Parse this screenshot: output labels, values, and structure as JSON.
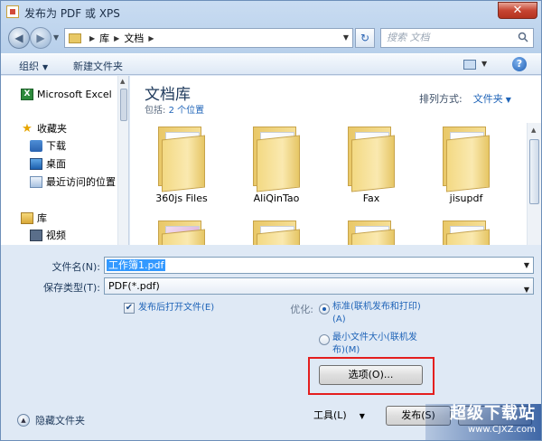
{
  "window": {
    "title": "发布为 PDF 或 XPS",
    "close": "✕"
  },
  "address": {
    "items": [
      "库",
      "文档"
    ],
    "search_placeholder": "搜索 文档"
  },
  "toolbar": {
    "organize": "组织",
    "new_folder": "新建文件夹",
    "help": "?"
  },
  "nav": {
    "items": [
      {
        "label": "Microsoft Excel"
      },
      {
        "label": "收藏夹"
      },
      {
        "label": "下载"
      },
      {
        "label": "桌面"
      },
      {
        "label": "最近访问的位置"
      },
      {
        "label": "库"
      },
      {
        "label": "视频"
      }
    ]
  },
  "main": {
    "title": "文档库",
    "includes_prefix": "包括:",
    "includes_link": "2 个位置",
    "arrange_label": "排列方式:",
    "arrange_value": "文件夹",
    "folders": [
      "360js Files",
      "AliQinTao",
      "Fax",
      "jisupdf"
    ]
  },
  "form": {
    "filename_label": "文件名(N):",
    "filename_value": "工作簿1.pdf",
    "filetype_label": "保存类型(T):",
    "filetype_value": "PDF(*.pdf)",
    "open_after": "发布后打开文件(E)",
    "optimize_label": "优化:",
    "opt_standard_1": "标准(联机发布和打印)",
    "opt_standard_2": "(A)",
    "opt_min_1": "最小文件大小(联机发",
    "opt_min_2": "布)(M)",
    "options_button": "选项(O)...",
    "tools_button": "工具(L)",
    "publish_button": "发布(S)",
    "hide_folders": "隐藏文件夹"
  },
  "watermark": {
    "big": "超级下载站",
    "small": "www.CJXZ.com"
  },
  "colors": {
    "highlight": "#e41e1e",
    "link": "#1f64b8"
  }
}
